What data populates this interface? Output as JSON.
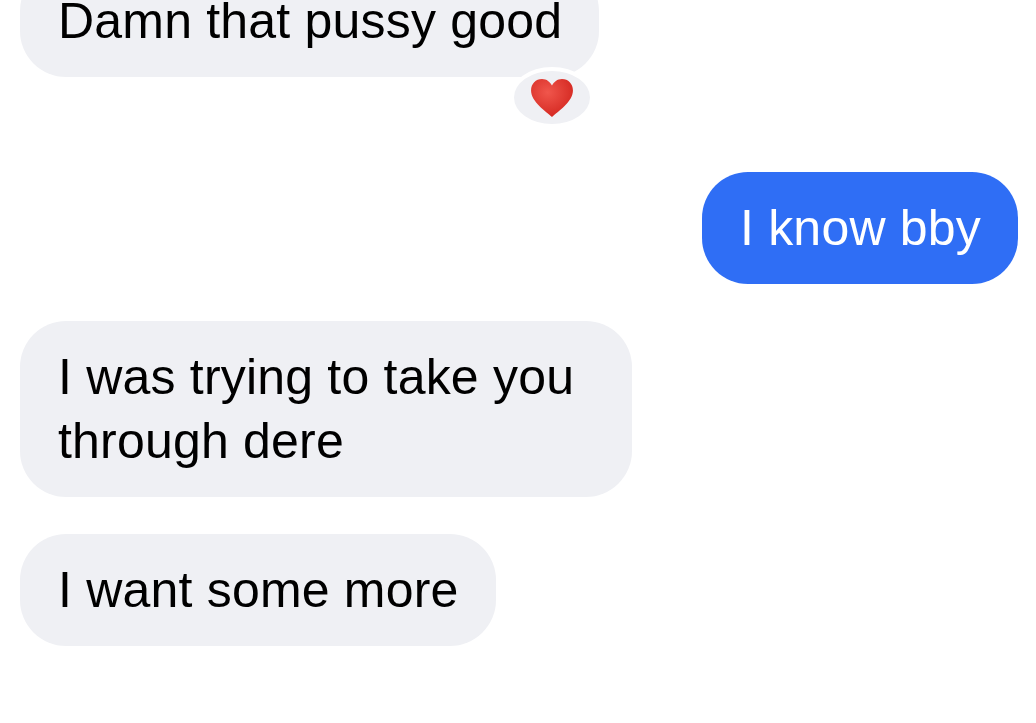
{
  "messages": [
    {
      "kind": "received",
      "text": "Damn that pussy good",
      "reacted": true
    },
    {
      "kind": "sent",
      "text": "I know bby",
      "reacted": false
    },
    {
      "kind": "received",
      "text": "I was trying to take you through dere",
      "reacted": false
    },
    {
      "kind": "received",
      "text": "I want some more",
      "reacted": false
    }
  ]
}
